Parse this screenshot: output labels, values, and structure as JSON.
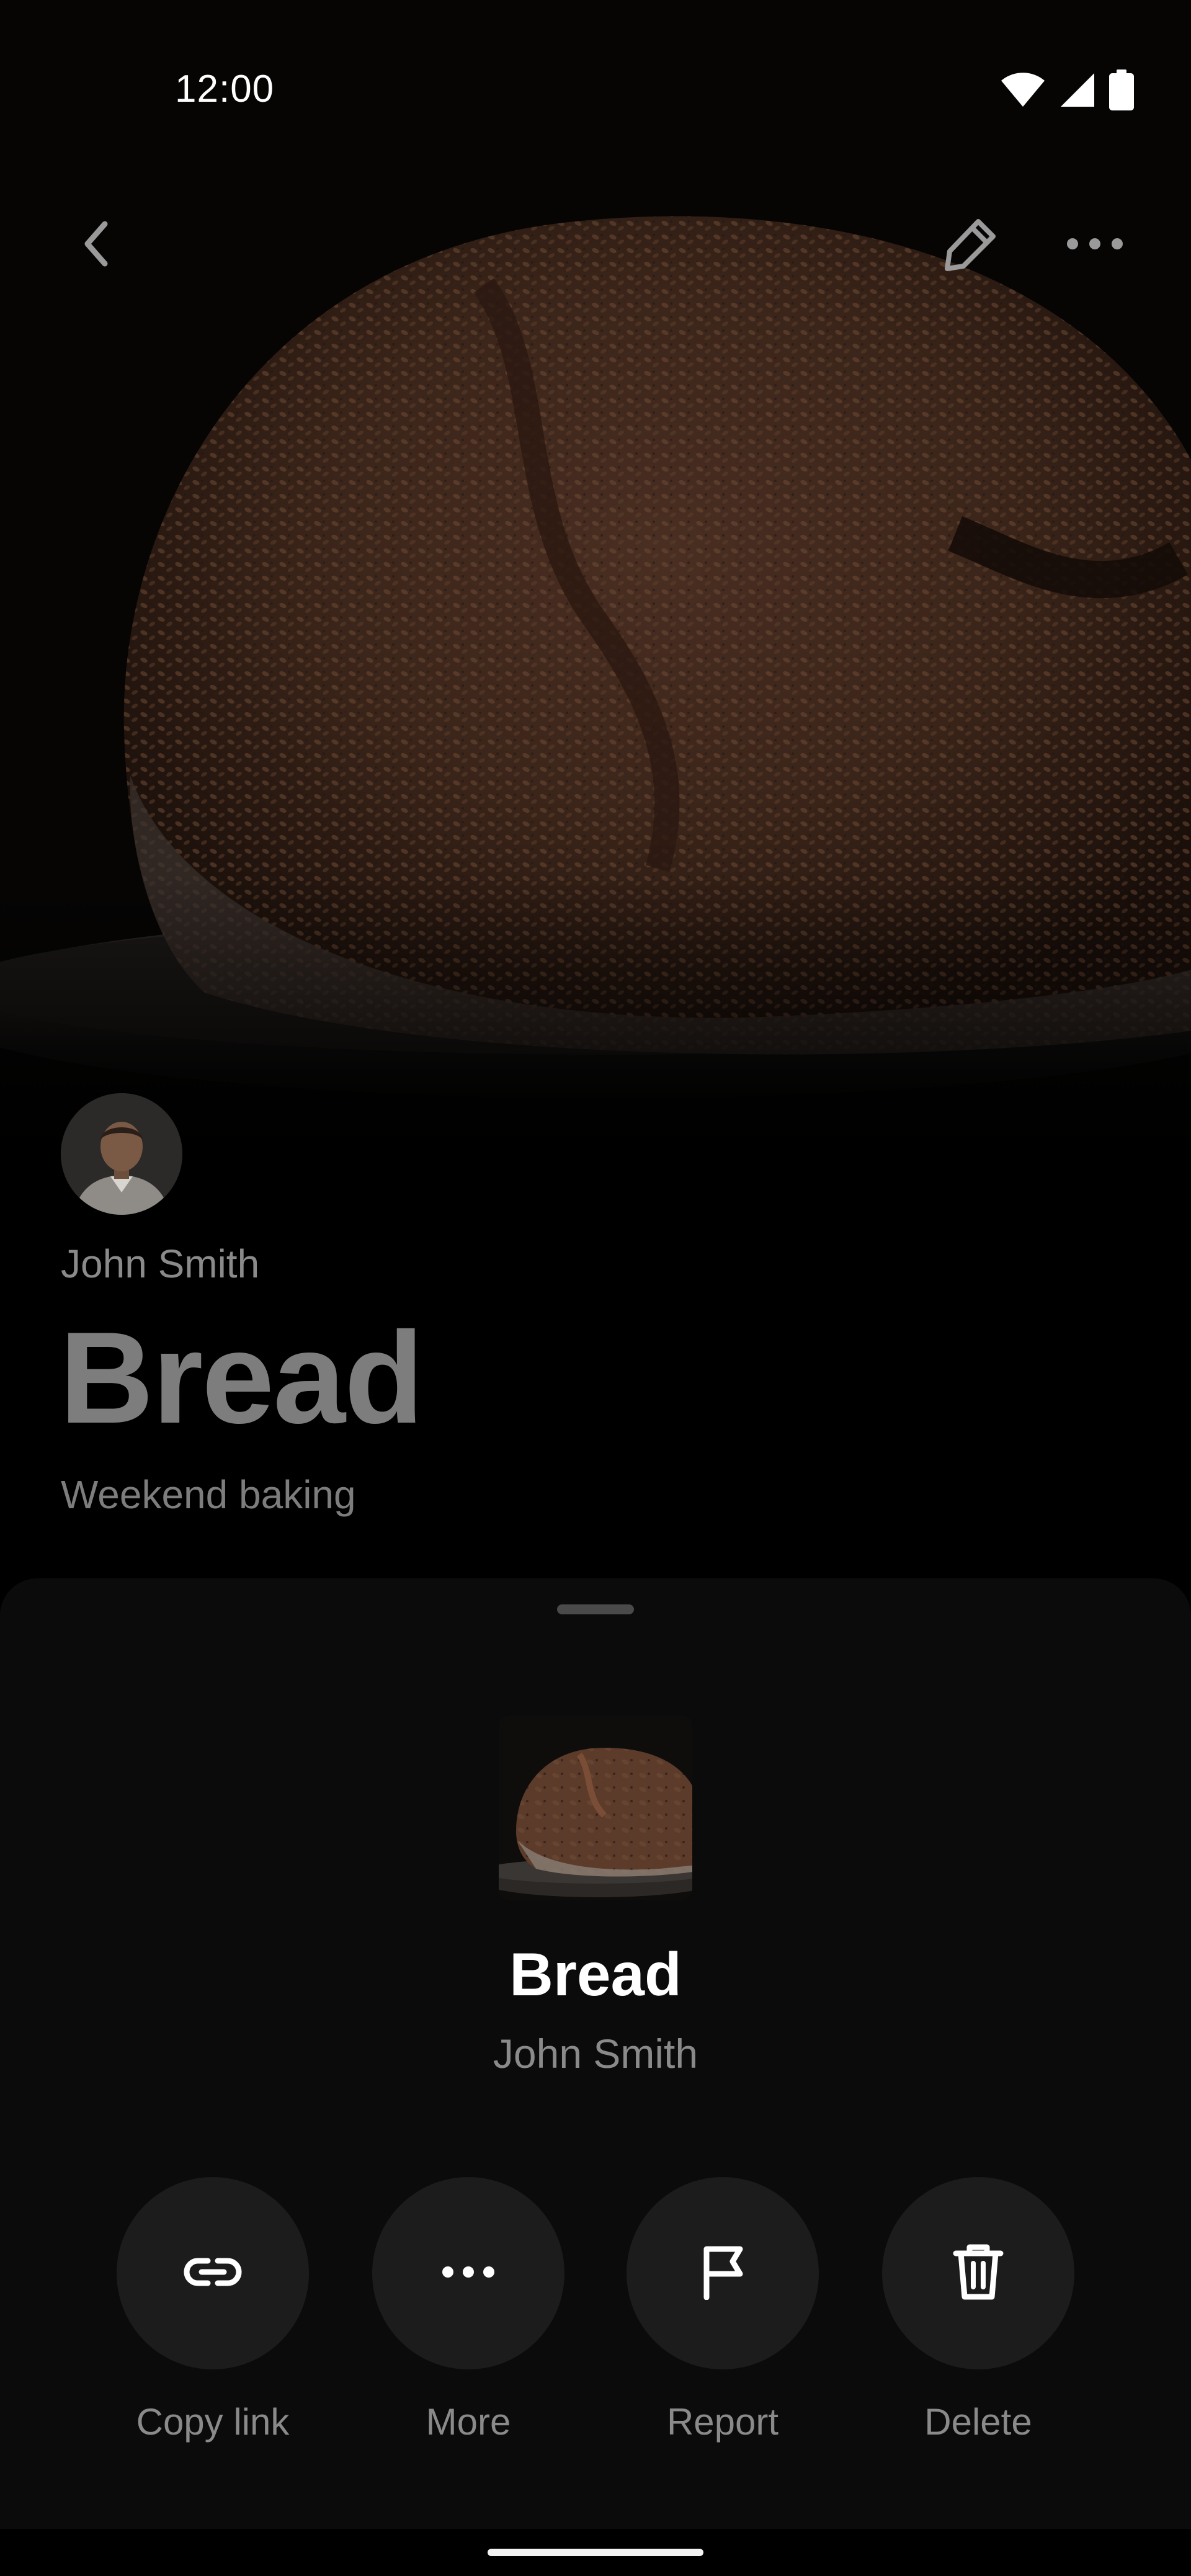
{
  "status_bar": {
    "time": "12:00",
    "icons": [
      "wifi-icon",
      "signal-icon",
      "battery-icon"
    ]
  },
  "app_bar": {
    "back_icon": "chevron-left-icon",
    "edit_icon": "pencil-icon",
    "more_icon": "more-horizontal-icon"
  },
  "profile": {
    "author": "John Smith",
    "title": "Bread",
    "subtitle": "Weekend baking"
  },
  "sheet": {
    "title": "Bread",
    "author": "John Smith",
    "actions": [
      {
        "label": "Copy link",
        "icon": "link-icon"
      },
      {
        "label": "More",
        "icon": "more-horizontal-icon"
      },
      {
        "label": "Report",
        "icon": "flag-icon"
      },
      {
        "label": "Delete",
        "icon": "trash-icon"
      }
    ]
  },
  "colors": {
    "background": "#000000",
    "sheet": "#0b0b0b",
    "action_circle": "#1c1c1c",
    "muted_text": "#8a8a8a",
    "dim_title": "#7d7d7d"
  }
}
